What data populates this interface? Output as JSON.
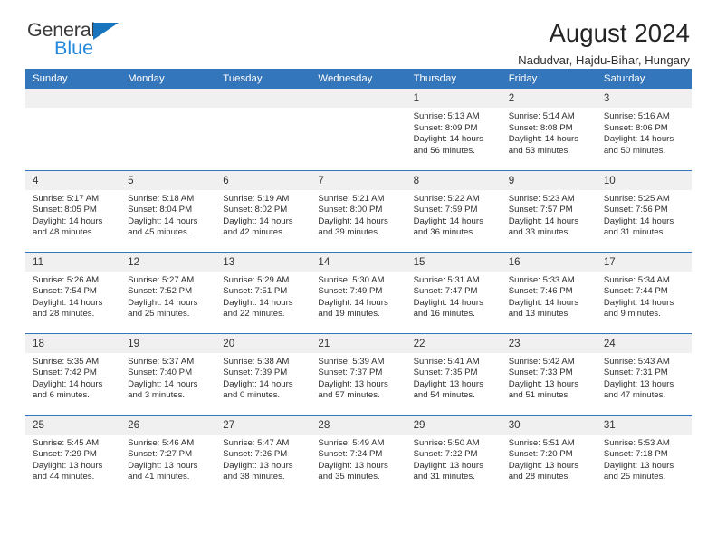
{
  "logo": {
    "word1": "General",
    "word2": "Blue",
    "triangle_color": "#1874bd",
    "text_color": "#3a3a3a",
    "blue_color": "#2288dd"
  },
  "header": {
    "title": "August 2024",
    "subtitle": "Nadudvar, Hajdu-Bihar, Hungary"
  },
  "theme": {
    "header_blue": "#3476bc",
    "daynum_band": "#f0f0f0",
    "text": "#2e2e2e"
  },
  "calendar": {
    "weekdays": [
      "Sunday",
      "Monday",
      "Tuesday",
      "Wednesday",
      "Thursday",
      "Friday",
      "Saturday"
    ],
    "weeks": [
      [
        {
          "day": "",
          "empty": true
        },
        {
          "day": "",
          "empty": true
        },
        {
          "day": "",
          "empty": true
        },
        {
          "day": "",
          "empty": true
        },
        {
          "day": "1",
          "sunrise": "Sunrise: 5:13 AM",
          "sunset": "Sunset: 8:09 PM",
          "daylight": "Daylight: 14 hours and 56 minutes."
        },
        {
          "day": "2",
          "sunrise": "Sunrise: 5:14 AM",
          "sunset": "Sunset: 8:08 PM",
          "daylight": "Daylight: 14 hours and 53 minutes."
        },
        {
          "day": "3",
          "sunrise": "Sunrise: 5:16 AM",
          "sunset": "Sunset: 8:06 PM",
          "daylight": "Daylight: 14 hours and 50 minutes."
        }
      ],
      [
        {
          "day": "4",
          "sunrise": "Sunrise: 5:17 AM",
          "sunset": "Sunset: 8:05 PM",
          "daylight": "Daylight: 14 hours and 48 minutes."
        },
        {
          "day": "5",
          "sunrise": "Sunrise: 5:18 AM",
          "sunset": "Sunset: 8:04 PM",
          "daylight": "Daylight: 14 hours and 45 minutes."
        },
        {
          "day": "6",
          "sunrise": "Sunrise: 5:19 AM",
          "sunset": "Sunset: 8:02 PM",
          "daylight": "Daylight: 14 hours and 42 minutes."
        },
        {
          "day": "7",
          "sunrise": "Sunrise: 5:21 AM",
          "sunset": "Sunset: 8:00 PM",
          "daylight": "Daylight: 14 hours and 39 minutes."
        },
        {
          "day": "8",
          "sunrise": "Sunrise: 5:22 AM",
          "sunset": "Sunset: 7:59 PM",
          "daylight": "Daylight: 14 hours and 36 minutes."
        },
        {
          "day": "9",
          "sunrise": "Sunrise: 5:23 AM",
          "sunset": "Sunset: 7:57 PM",
          "daylight": "Daylight: 14 hours and 33 minutes."
        },
        {
          "day": "10",
          "sunrise": "Sunrise: 5:25 AM",
          "sunset": "Sunset: 7:56 PM",
          "daylight": "Daylight: 14 hours and 31 minutes."
        }
      ],
      [
        {
          "day": "11",
          "sunrise": "Sunrise: 5:26 AM",
          "sunset": "Sunset: 7:54 PM",
          "daylight": "Daylight: 14 hours and 28 minutes."
        },
        {
          "day": "12",
          "sunrise": "Sunrise: 5:27 AM",
          "sunset": "Sunset: 7:52 PM",
          "daylight": "Daylight: 14 hours and 25 minutes."
        },
        {
          "day": "13",
          "sunrise": "Sunrise: 5:29 AM",
          "sunset": "Sunset: 7:51 PM",
          "daylight": "Daylight: 14 hours and 22 minutes."
        },
        {
          "day": "14",
          "sunrise": "Sunrise: 5:30 AM",
          "sunset": "Sunset: 7:49 PM",
          "daylight": "Daylight: 14 hours and 19 minutes."
        },
        {
          "day": "15",
          "sunrise": "Sunrise: 5:31 AM",
          "sunset": "Sunset: 7:47 PM",
          "daylight": "Daylight: 14 hours and 16 minutes."
        },
        {
          "day": "16",
          "sunrise": "Sunrise: 5:33 AM",
          "sunset": "Sunset: 7:46 PM",
          "daylight": "Daylight: 14 hours and 13 minutes."
        },
        {
          "day": "17",
          "sunrise": "Sunrise: 5:34 AM",
          "sunset": "Sunset: 7:44 PM",
          "daylight": "Daylight: 14 hours and 9 minutes."
        }
      ],
      [
        {
          "day": "18",
          "sunrise": "Sunrise: 5:35 AM",
          "sunset": "Sunset: 7:42 PM",
          "daylight": "Daylight: 14 hours and 6 minutes."
        },
        {
          "day": "19",
          "sunrise": "Sunrise: 5:37 AM",
          "sunset": "Sunset: 7:40 PM",
          "daylight": "Daylight: 14 hours and 3 minutes."
        },
        {
          "day": "20",
          "sunrise": "Sunrise: 5:38 AM",
          "sunset": "Sunset: 7:39 PM",
          "daylight": "Daylight: 14 hours and 0 minutes."
        },
        {
          "day": "21",
          "sunrise": "Sunrise: 5:39 AM",
          "sunset": "Sunset: 7:37 PM",
          "daylight": "Daylight: 13 hours and 57 minutes."
        },
        {
          "day": "22",
          "sunrise": "Sunrise: 5:41 AM",
          "sunset": "Sunset: 7:35 PM",
          "daylight": "Daylight: 13 hours and 54 minutes."
        },
        {
          "day": "23",
          "sunrise": "Sunrise: 5:42 AM",
          "sunset": "Sunset: 7:33 PM",
          "daylight": "Daylight: 13 hours and 51 minutes."
        },
        {
          "day": "24",
          "sunrise": "Sunrise: 5:43 AM",
          "sunset": "Sunset: 7:31 PM",
          "daylight": "Daylight: 13 hours and 47 minutes."
        }
      ],
      [
        {
          "day": "25",
          "sunrise": "Sunrise: 5:45 AM",
          "sunset": "Sunset: 7:29 PM",
          "daylight": "Daylight: 13 hours and 44 minutes."
        },
        {
          "day": "26",
          "sunrise": "Sunrise: 5:46 AM",
          "sunset": "Sunset: 7:27 PM",
          "daylight": "Daylight: 13 hours and 41 minutes."
        },
        {
          "day": "27",
          "sunrise": "Sunrise: 5:47 AM",
          "sunset": "Sunset: 7:26 PM",
          "daylight": "Daylight: 13 hours and 38 minutes."
        },
        {
          "day": "28",
          "sunrise": "Sunrise: 5:49 AM",
          "sunset": "Sunset: 7:24 PM",
          "daylight": "Daylight: 13 hours and 35 minutes."
        },
        {
          "day": "29",
          "sunrise": "Sunrise: 5:50 AM",
          "sunset": "Sunset: 7:22 PM",
          "daylight": "Daylight: 13 hours and 31 minutes."
        },
        {
          "day": "30",
          "sunrise": "Sunrise: 5:51 AM",
          "sunset": "Sunset: 7:20 PM",
          "daylight": "Daylight: 13 hours and 28 minutes."
        },
        {
          "day": "31",
          "sunrise": "Sunrise: 5:53 AM",
          "sunset": "Sunset: 7:18 PM",
          "daylight": "Daylight: 13 hours and 25 minutes."
        }
      ]
    ]
  }
}
